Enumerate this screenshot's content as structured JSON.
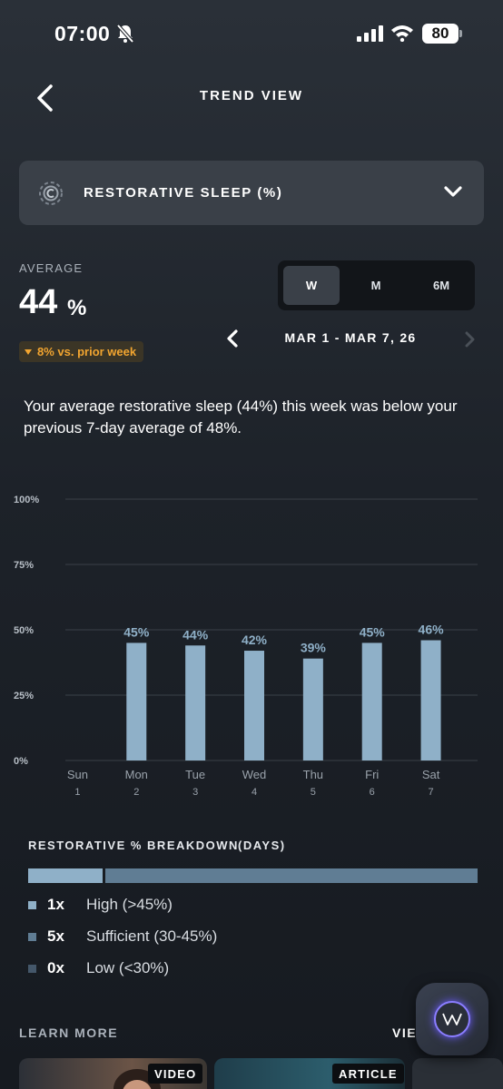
{
  "status_bar": {
    "time": "07:00",
    "battery": "80",
    "icons": [
      "bell-slash-icon",
      "signal-icon",
      "wifi-icon",
      "battery-icon"
    ]
  },
  "header": {
    "title": "TREND VIEW",
    "back_icon": "chevron-left-icon"
  },
  "metric_selector": {
    "icon": "restorative-sleep-icon",
    "label": "RESTORATIVE SLEEP (%)",
    "chevron_icon": "chevron-down-icon"
  },
  "average": {
    "label": "AVERAGE",
    "value": "44",
    "unit": "%",
    "delta": "8% vs. prior week",
    "delta_color": "#f2a530"
  },
  "period_toggle": {
    "options": [
      "W",
      "M",
      "6M"
    ],
    "selected": "W"
  },
  "date_nav": {
    "range": "MAR 1 - MAR 7, 26",
    "prev_icon": "chevron-left-icon",
    "next_icon": "chevron-right-icon"
  },
  "summary": "Your average restorative sleep (44%) this week was below your previous 7-day average of 48%.",
  "chart_data": {
    "type": "bar",
    "categories": [
      "Sun",
      "Mon",
      "Tue",
      "Wed",
      "Thu",
      "Fri",
      "Sat"
    ],
    "day_numbers": [
      "1",
      "2",
      "3",
      "4",
      "5",
      "6",
      "7"
    ],
    "values": [
      null,
      45,
      44,
      42,
      39,
      45,
      46
    ],
    "value_labels": [
      "",
      "45%",
      "44%",
      "42%",
      "39%",
      "45%",
      "46%"
    ],
    "y_ticks": [
      "100%",
      "75%",
      "50%",
      "25%",
      "0%"
    ],
    "y_tick_values": [
      100,
      75,
      50,
      25,
      0
    ],
    "ylim": [
      0,
      100
    ],
    "grid": true,
    "bar_color": "#8fb0c8",
    "title": "",
    "xlabel": "",
    "ylabel": ""
  },
  "breakdown": {
    "title": "RESTORATIVE % BREAKDOWN",
    "subtitle": "(DAYS)",
    "items": [
      {
        "count": "1x",
        "label": "High (>45%)",
        "color": "#8fb0c8",
        "days": 1
      },
      {
        "count": "5x",
        "label": "Sufficient (30-45%)",
        "color": "#607d94",
        "days": 5
      },
      {
        "count": "0x",
        "label": "Low (<30%)",
        "color": "#44576a",
        "days": 0
      }
    ]
  },
  "learn_more": {
    "title": "LEARN MORE",
    "view_all": "VIE",
    "cards": [
      {
        "tag": "VIDEO"
      },
      {
        "tag": "ARTICLE"
      },
      {
        "tag": ""
      }
    ]
  },
  "assistant_button": {
    "icon": "whoop-coach-icon"
  }
}
